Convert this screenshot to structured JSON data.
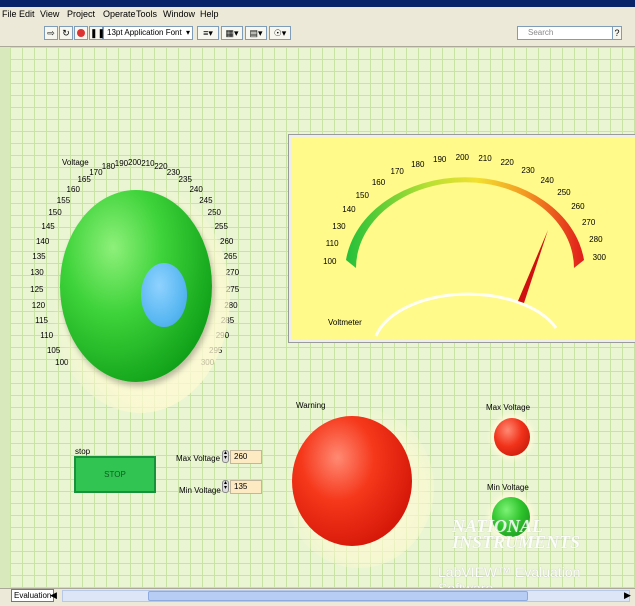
{
  "menu": {
    "items": [
      "File",
      "Edit",
      "View",
      "Project",
      "Operate",
      "Tools",
      "Window",
      "Help"
    ]
  },
  "toolbar": {
    "font_select": "13pt Application Font",
    "search_placeholder": "Search",
    "run_icon": "run-arrow-icon",
    "run_continuous_icon": "run-continuously-icon",
    "abort_icon": "abort-icon",
    "pause_icon": "pause-icon",
    "align_icon": "align-objects-icon",
    "distribute_icon": "distribute-objects-icon",
    "resize_icon": "resize-objects-icon",
    "reorder_icon": "reorder-icon"
  },
  "knob": {
    "label": "Voltage",
    "scale": [
      "100",
      "105",
      "110",
      "115",
      "120",
      "125",
      "130",
      "135",
      "140",
      "145",
      "150",
      "155",
      "160",
      "165",
      "170",
      "180",
      "190",
      "200",
      "210",
      "220",
      "230",
      "235",
      "240",
      "245",
      "250",
      "255",
      "260",
      "265",
      "270",
      "275",
      "280",
      "285",
      "290",
      "295",
      "300"
    ],
    "color": "#3ed33a",
    "indicator_color": "#5ab8f2"
  },
  "meter": {
    "label": "Voltmeter",
    "scale": [
      "100",
      "110",
      "130",
      "140",
      "150",
      "160",
      "170",
      "180",
      "190",
      "200",
      "210",
      "220",
      "230",
      "240",
      "250",
      "260",
      "270",
      "280",
      "300"
    ],
    "needle_value": 257,
    "face_color": "#fffa8a"
  },
  "stop": {
    "label": "stop",
    "button_text": "STOP",
    "color": "#32c452"
  },
  "controls": {
    "max_label": "Max Voltage",
    "max_value": "260",
    "min_label": "Min Voltage",
    "min_value": "135"
  },
  "indicators": {
    "warning_label": "Warning",
    "warning_color": "#f5371a",
    "max_label": "Max Voltage",
    "max_color": "#f1321a",
    "min_label": "Min Voltage",
    "min_color": "#2fc42c"
  },
  "watermark": {
    "brand_line1": "NATIONAL",
    "brand_line2": "INSTRUMENTS",
    "subtitle": "LabVIEW™ Evaluation Software"
  },
  "statusbar": {
    "tab": "Evaluation"
  }
}
